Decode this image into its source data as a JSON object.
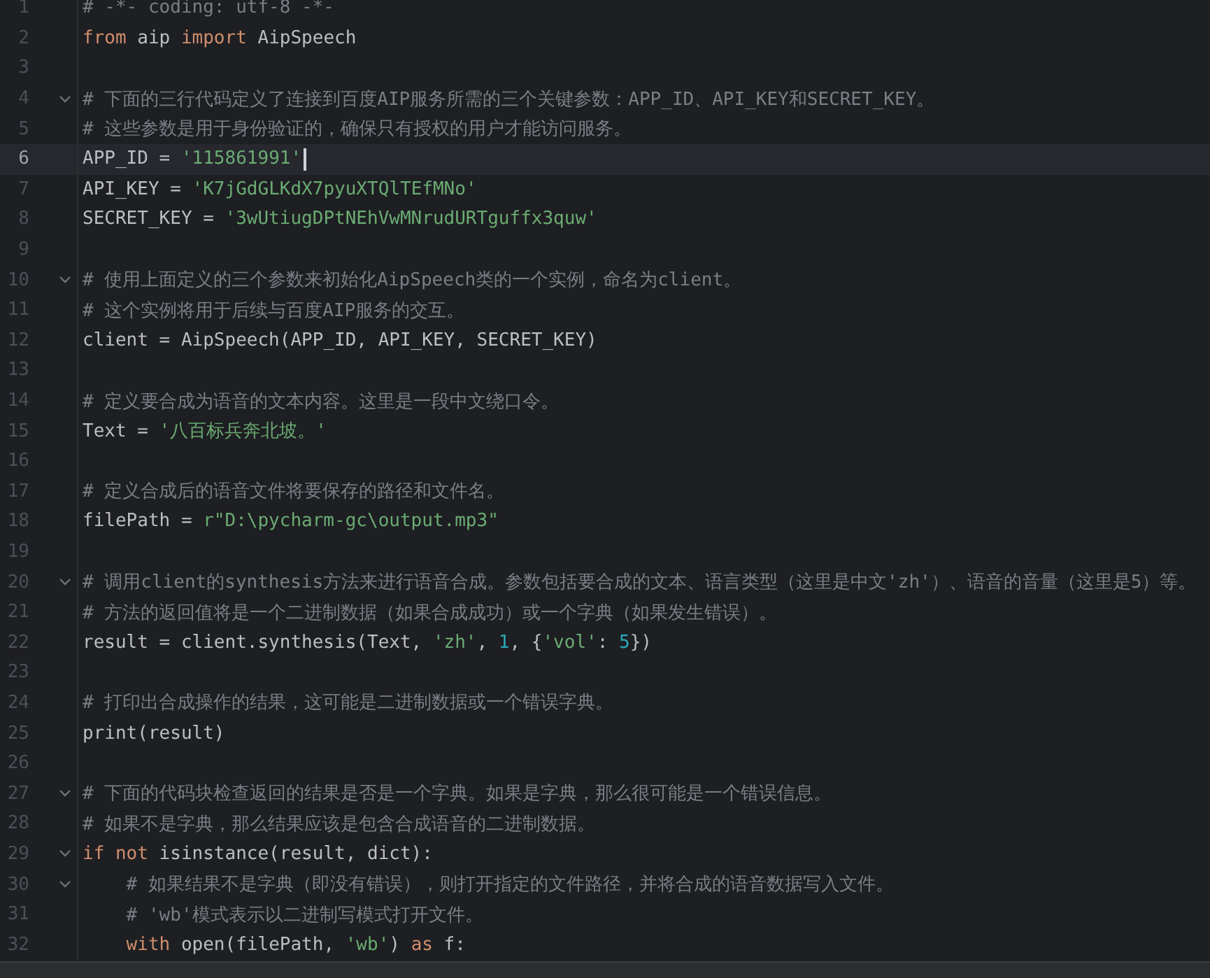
{
  "editor": {
    "lines": [
      {
        "number": "1",
        "fold": false,
        "current": false,
        "tokens": [
          {
            "kind": "comment",
            "text": "# -*- coding: utf-8 -*-"
          }
        ]
      },
      {
        "number": "2",
        "fold": false,
        "current": false,
        "tokens": [
          {
            "kind": "keyword",
            "text": "from"
          },
          {
            "kind": "plain",
            "text": " aip "
          },
          {
            "kind": "keyword",
            "text": "import"
          },
          {
            "kind": "plain",
            "text": " AipSpeech"
          }
        ]
      },
      {
        "number": "3",
        "fold": false,
        "current": false
      },
      {
        "number": "4",
        "fold": true,
        "current": false,
        "tokens": [
          {
            "kind": "comment",
            "text": "# 下面的三行代码定义了连接到百度AIP服务所需的三个关键参数：APP_ID、API_KEY和SECRET_KEY。"
          }
        ]
      },
      {
        "number": "5",
        "fold": false,
        "current": false,
        "tokens": [
          {
            "kind": "comment",
            "text": "# 这些参数是用于身份验证的，确保只有授权的用户才能访问服务。"
          }
        ]
      },
      {
        "number": "6",
        "fold": false,
        "current": true,
        "tokens": [
          {
            "kind": "plain",
            "text": "APP_ID = "
          },
          {
            "kind": "string",
            "text": "'115861991'"
          }
        ]
      },
      {
        "number": "7",
        "fold": false,
        "current": false,
        "tokens": [
          {
            "kind": "plain",
            "text": "API_KEY = "
          },
          {
            "kind": "string",
            "text": "'K7jGdGLKdX7pyuXTQlTEfMNo'"
          }
        ]
      },
      {
        "number": "8",
        "fold": false,
        "current": false,
        "tokens": [
          {
            "kind": "plain",
            "text": "SECRET_KEY = "
          },
          {
            "kind": "string",
            "text": "'3wUtiugDPtNEhVwMNrudURTguffx3quw'"
          }
        ]
      },
      {
        "number": "9",
        "fold": false,
        "current": false
      },
      {
        "number": "10",
        "fold": true,
        "current": false,
        "tokens": [
          {
            "kind": "comment",
            "text": "# 使用上面定义的三个参数来初始化AipSpeech类的一个实例，命名为client。"
          }
        ]
      },
      {
        "number": "11",
        "fold": false,
        "current": false,
        "tokens": [
          {
            "kind": "comment",
            "text": "# 这个实例将用于后续与百度AIP服务的交互。"
          }
        ]
      },
      {
        "number": "12",
        "fold": false,
        "current": false,
        "tokens": [
          {
            "kind": "plain",
            "text": "client = AipSpeech(APP_ID, API_KEY, SECRET_KEY)"
          }
        ]
      },
      {
        "number": "13",
        "fold": false,
        "current": false
      },
      {
        "number": "14",
        "fold": false,
        "current": false,
        "tokens": [
          {
            "kind": "comment",
            "text": "# 定义要合成为语音的文本内容。这里是一段中文绕口令。"
          }
        ]
      },
      {
        "number": "15",
        "fold": false,
        "current": false,
        "tokens": [
          {
            "kind": "plain",
            "text": "Text = "
          },
          {
            "kind": "string",
            "text": "'八百标兵奔北坡。'"
          }
        ]
      },
      {
        "number": "16",
        "fold": false,
        "current": false
      },
      {
        "number": "17",
        "fold": false,
        "current": false,
        "tokens": [
          {
            "kind": "comment",
            "text": "# 定义合成后的语音文件将要保存的路径和文件名。"
          }
        ]
      },
      {
        "number": "18",
        "fold": false,
        "current": false,
        "tokens": [
          {
            "kind": "plain",
            "text": "filePath = "
          },
          {
            "kind": "string",
            "text": "r\"D:\\pycharm-gc\\output.mp3\""
          }
        ]
      },
      {
        "number": "19",
        "fold": false,
        "current": false
      },
      {
        "number": "20",
        "fold": true,
        "current": false,
        "tokens": [
          {
            "kind": "comment",
            "text": "# 调用client的synthesis方法来进行语音合成。参数包括要合成的文本、语言类型（这里是中文'zh'）、语音的音量（这里是5）等。"
          }
        ]
      },
      {
        "number": "21",
        "fold": false,
        "current": false,
        "tokens": [
          {
            "kind": "comment",
            "text": "# 方法的返回值将是一个二进制数据（如果合成成功）或一个字典（如果发生错误）。"
          }
        ]
      },
      {
        "number": "22",
        "fold": false,
        "current": false,
        "tokens": [
          {
            "kind": "plain",
            "text": "result = client.synthesis(Text, "
          },
          {
            "kind": "string",
            "text": "'zh'"
          },
          {
            "kind": "plain",
            "text": ", "
          },
          {
            "kind": "number",
            "text": "1"
          },
          {
            "kind": "plain",
            "text": ", {"
          },
          {
            "kind": "string",
            "text": "'vol'"
          },
          {
            "kind": "plain",
            "text": ": "
          },
          {
            "kind": "number",
            "text": "5"
          },
          {
            "kind": "plain",
            "text": "})"
          }
        ]
      },
      {
        "number": "23",
        "fold": false,
        "current": false
      },
      {
        "number": "24",
        "fold": false,
        "current": false,
        "tokens": [
          {
            "kind": "comment",
            "text": "# 打印出合成操作的结果，这可能是二进制数据或一个错误字典。"
          }
        ]
      },
      {
        "number": "25",
        "fold": false,
        "current": false,
        "tokens": [
          {
            "kind": "plain",
            "text": "print(result)"
          }
        ]
      },
      {
        "number": "26",
        "fold": false,
        "current": false
      },
      {
        "number": "27",
        "fold": true,
        "current": false,
        "tokens": [
          {
            "kind": "comment",
            "text": "# 下面的代码块检查返回的结果是否是一个字典。如果是字典，那么很可能是一个错误信息。"
          }
        ]
      },
      {
        "number": "28",
        "fold": false,
        "current": false,
        "tokens": [
          {
            "kind": "comment",
            "text": "# 如果不是字典，那么结果应该是包含合成语音的二进制数据。"
          }
        ]
      },
      {
        "number": "29",
        "fold": true,
        "current": false,
        "tokens": [
          {
            "kind": "keyword",
            "text": "if not"
          },
          {
            "kind": "plain",
            "text": " isinstance(result, dict):"
          }
        ]
      },
      {
        "number": "30",
        "fold": true,
        "current": false,
        "tokens": [
          {
            "kind": "comment",
            "text": "    # 如果结果不是字典（即没有错误），则打开指定的文件路径，并将合成的语音数据写入文件。"
          }
        ]
      },
      {
        "number": "31",
        "fold": false,
        "current": false,
        "tokens": [
          {
            "kind": "comment",
            "text": "    # 'wb'模式表示以二进制写模式打开文件。"
          }
        ]
      },
      {
        "number": "32",
        "fold": false,
        "current": false,
        "tokens": [
          {
            "kind": "keyword",
            "text": "    with"
          },
          {
            "kind": "plain",
            "text": " open(filePath, "
          },
          {
            "kind": "string",
            "text": "'wb'"
          },
          {
            "kind": "plain",
            "text": ") "
          },
          {
            "kind": "keyword",
            "text": "as"
          },
          {
            "kind": "plain",
            "text": " f:"
          }
        ]
      }
    ]
  }
}
